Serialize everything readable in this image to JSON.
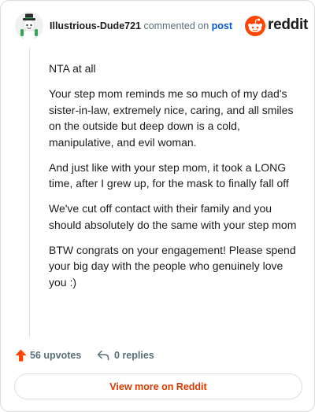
{
  "comment": {
    "username": "Illustrious-Dude721",
    "commented_text": "commented on",
    "post_link": "post",
    "paragraphs": [
      "NTA at all",
      "Your step mom reminds me so much of my dad's sister-in-law, extremely nice, caring, and all smiles on the outside but deep down is a cold, manipulative, and evil woman.",
      "And just like with your step mom, it took a LONG time, after I grew up, for the mask to finally fall off",
      "We've cut off contact with their family and you should absolutely do the same with your step mom",
      "BTW congrats on your engagement! Please spend your big day with the people who genuinely love you :)"
    ]
  },
  "brand": {
    "wordmark": "reddit",
    "icon": "reddit-logo-icon",
    "color": "#ff4500"
  },
  "footer": {
    "upvotes": "56 upvotes",
    "replies": "0 replies",
    "upvote_icon": "upvote-arrow-icon",
    "reply_icon": "reply-arrow-icon"
  },
  "cta": {
    "label": "View more on Reddit"
  },
  "colors": {
    "accent": "#ff4500",
    "link": "#0a54d6",
    "muted": "#576f76",
    "cta_text": "#d93900"
  }
}
